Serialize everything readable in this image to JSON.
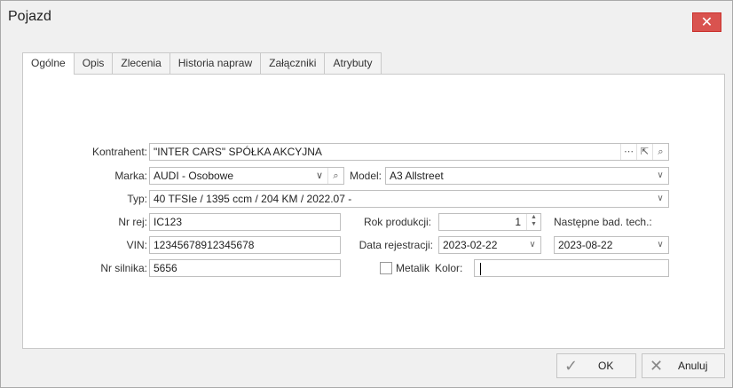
{
  "window": {
    "title": "Pojazd",
    "close_symbol": "✕"
  },
  "tabs": [
    {
      "label": "Ogólne"
    },
    {
      "label": "Opis"
    },
    {
      "label": "Zlecenia"
    },
    {
      "label": "Historia napraw"
    },
    {
      "label": "Załączniki"
    },
    {
      "label": "Atrybuty"
    }
  ],
  "form": {
    "kontrahent_label": "Kontrahent:",
    "kontrahent_value": "\"INTER CARS\" SPÓŁKA AKCYJNA",
    "marka_label": "Marka:",
    "marka_value": "AUDI - Osobowe",
    "model_label": "Model:",
    "model_value": "A3 Allstreet",
    "typ_label": "Typ:",
    "typ_value": "40 TFSIe / 1395 ccm / 204 KM / 2022.07 -",
    "nr_rej_label": "Nr rej:",
    "nr_rej_value": "IC123",
    "rok_label": "Rok produkcji:",
    "rok_value": "1",
    "nastepne_label": "Następne bad. tech.:",
    "vin_label": "VIN:",
    "vin_value": "12345678912345678",
    "data_rej_label": "Data rejestracji:",
    "data_rej_value": "2023-02-22",
    "nastepne_value": "2023-08-22",
    "nr_silnika_label": "Nr silnika:",
    "nr_silnika_value": "5656",
    "metalik_label": "Metalik",
    "kolor_label": "Kolor:",
    "kolor_value": ""
  },
  "buttons": {
    "ok_label": "OK",
    "cancel_label": "Anuluj"
  },
  "icons": {
    "ellipsis": "⋯",
    "link": "⇱",
    "search": "⌕",
    "chevron": "∨",
    "check": "✓",
    "cross": "✕"
  }
}
